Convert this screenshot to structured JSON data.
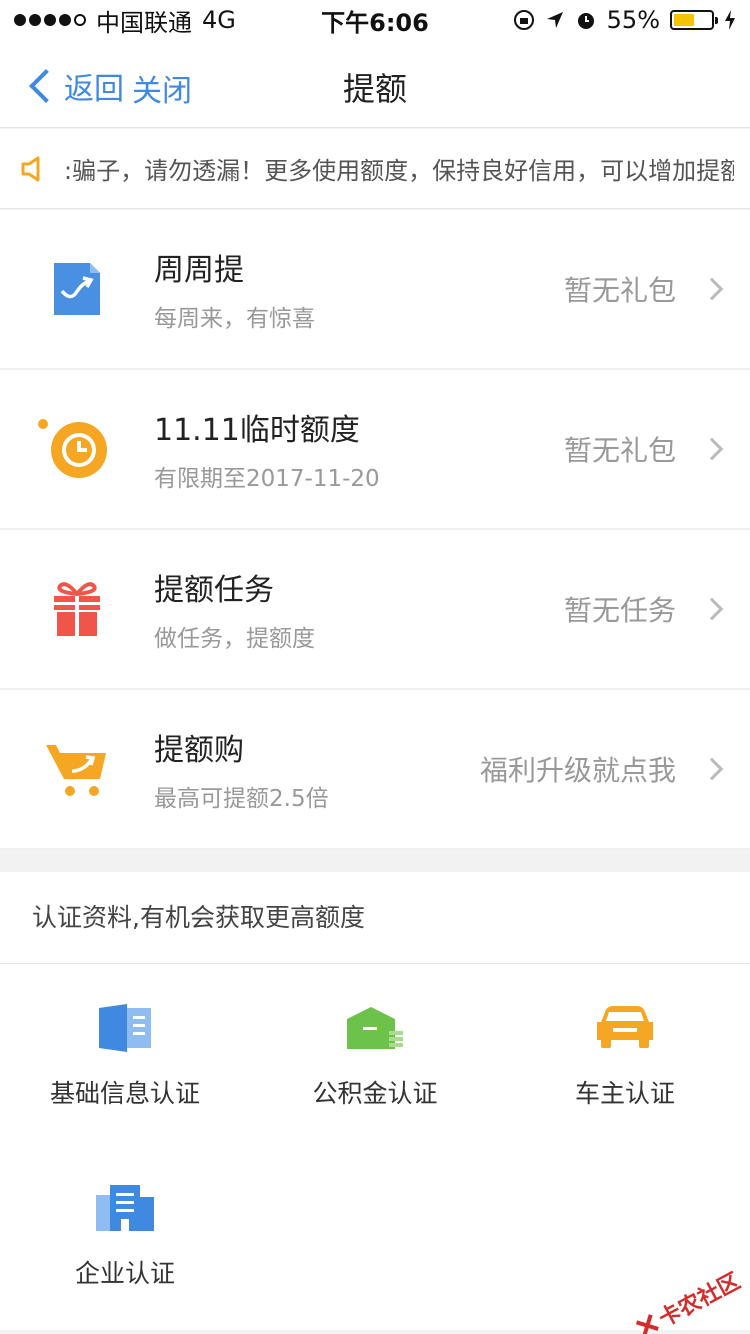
{
  "status_bar": {
    "carrier": "中国联通",
    "network": "4G",
    "time": "下午6:06",
    "battery": "55%",
    "battery_level": 0.55
  },
  "nav": {
    "back_label": "返回",
    "close_label": "关闭",
    "title": "提额"
  },
  "notice": {
    "text": ":骗子，请勿透漏！更多使用额度，保持良好信用，可以增加提额"
  },
  "cards": [
    {
      "title": "周周提",
      "sub": "每周来，有惊喜",
      "right": "暂无礼包",
      "icon": "weekly-chart-icon",
      "color": "#4a90e2"
    },
    {
      "title": "11.11临时额度",
      "sub": "有限期至2017-11-20",
      "right": "暂无礼包",
      "icon": "clock-icon",
      "color": "#f5a623"
    },
    {
      "title": "提额任务",
      "sub": "做任务，提额度",
      "right": "暂无任务",
      "icon": "gift-icon",
      "color": "#f0554a"
    },
    {
      "title": "提额购",
      "sub": "最高可提额2.5倍",
      "right": "福利升级就点我",
      "icon": "cart-icon",
      "color": "#f5a623"
    }
  ],
  "auth": {
    "header": "认证资料,有机会获取更高额度",
    "items": [
      {
        "label": "基础信息认证",
        "icon": "id-card-icon"
      },
      {
        "label": "公积金认证",
        "icon": "warehouse-icon"
      },
      {
        "label": "车主认证",
        "icon": "car-icon"
      },
      {
        "label": "企业认证",
        "icon": "building-icon"
      }
    ]
  },
  "watermark": "卡农社区",
  "colors": {
    "accent": "#3f8ae0",
    "blue": "#4a90e2",
    "orange": "#f5a623",
    "red": "#f0554a",
    "green": "#6cc24a"
  }
}
